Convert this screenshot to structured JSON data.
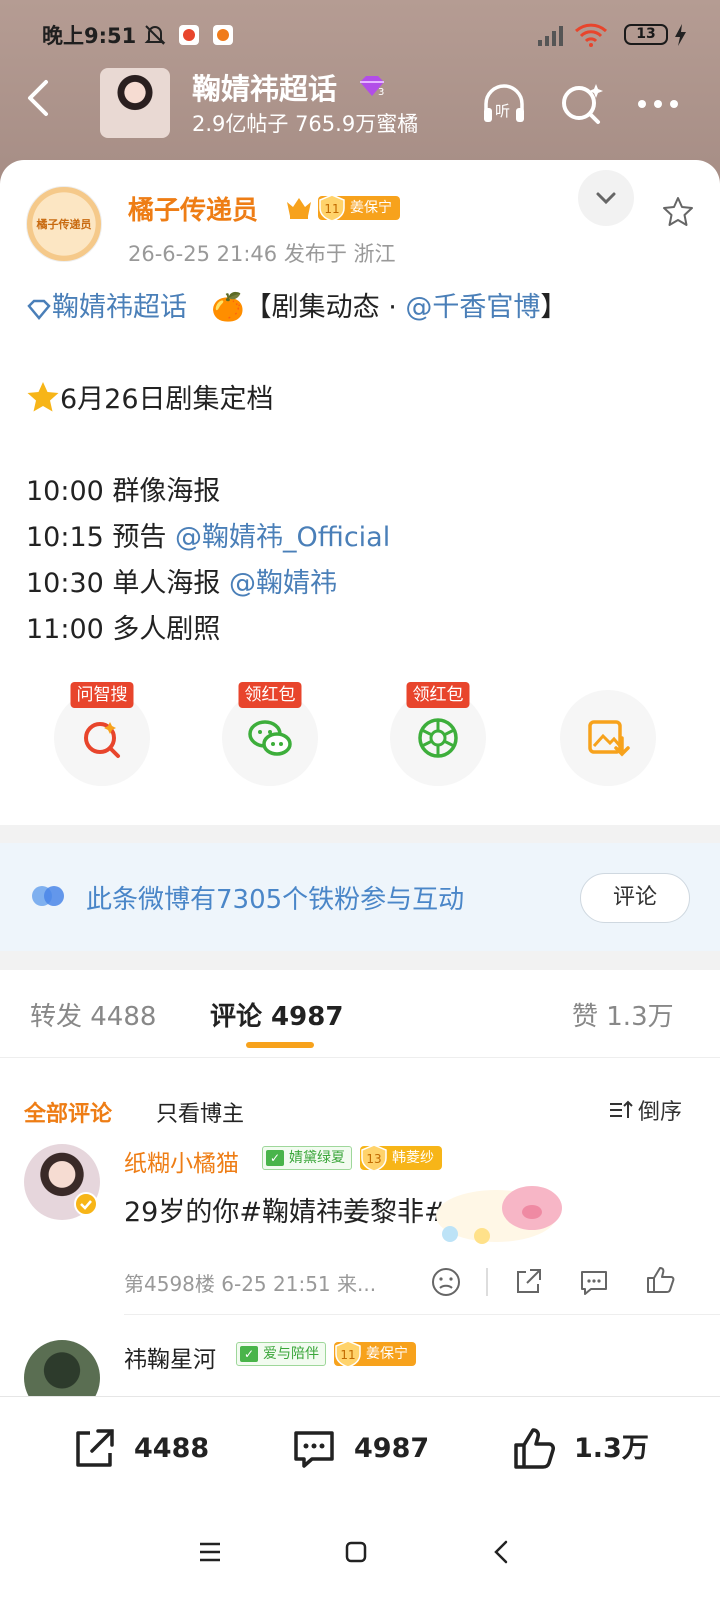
{
  "status_bar": {
    "time": "晚上9:51",
    "battery": "13"
  },
  "header": {
    "title": "鞠婧祎超话",
    "level_badge": "3",
    "stats": "2.9亿帖子 765.9万蜜橘"
  },
  "post": {
    "author": "橘子传递员",
    "author_avatar_text": "橘子传递员",
    "badge_level": "11",
    "badge_text": "姜保宁",
    "time_location": "26-6-25 21:46  发布于 浙江",
    "line1_topic": "鞠婧祎超话",
    "line1_emoji": "🍊",
    "line1_rest": "【剧集动态 · ",
    "line1_link": "@千香官博",
    "line1_end": "】",
    "line2": "6月26日剧集定档",
    "line3": "10:00 群像海报",
    "line4_prefix": "10:15 预告 ",
    "line4_link": "@鞠婧祎_Official",
    "line5_prefix": "10:30 单人海报 ",
    "line5_link": "@鞠婧祎",
    "line6": "11:00 多人剧照"
  },
  "actions": [
    {
      "tag": "问智搜"
    },
    {
      "tag": "领红包"
    },
    {
      "tag": "领红包"
    },
    {
      "tag": ""
    }
  ],
  "fan_bar": {
    "text": "此条微博有7305个铁粉参与互动",
    "button": "评论"
  },
  "tabs": {
    "repost": "转发 4488",
    "comment": "评论 4987",
    "like": "赞 1.3万"
  },
  "comment_filter": {
    "all": "全部评论",
    "author_only": "只看博主",
    "sort": "倒序"
  },
  "comments": [
    {
      "name": "纸糊小橘猫",
      "group_badge": "婧黛绿夏",
      "level": "13",
      "level_text": "韩菱纱",
      "text": "29岁的你#鞠婧祎姜黎非#",
      "meta": "第4598楼  6-25 21:51  来..."
    },
    {
      "name": "祎鞠星河",
      "group_badge": "爱与陪伴",
      "level": "11",
      "level_text": "姜保宁"
    }
  ],
  "bottom_bar": {
    "repost": "4488",
    "comment": "4987",
    "like": "1.3万"
  },
  "colors": {
    "accent_orange": "#ee7d15",
    "badge_orange": "#f7a21c",
    "link_blue": "#4a7fb8",
    "tag_red": "#e8452c"
  }
}
